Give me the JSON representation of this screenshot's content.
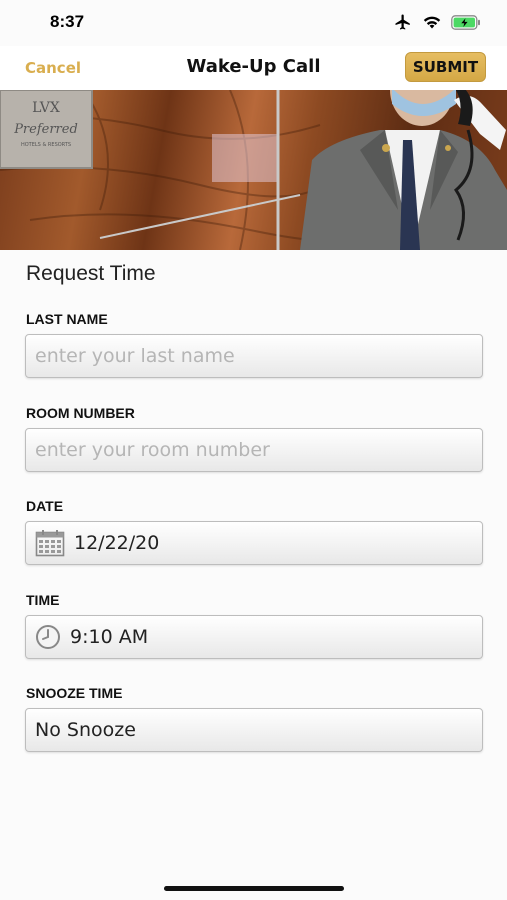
{
  "status": {
    "time": "8:37",
    "icons": [
      "airplane-icon",
      "wifi-icon",
      "battery-charging-icon"
    ],
    "battery_color": "#4cd964"
  },
  "nav": {
    "cancel_label": "Cancel",
    "title": "Wake-Up Call",
    "submit_label": "SUBMIT"
  },
  "colors": {
    "accent": "#d9ae4f",
    "submit_bg": "#e0b556"
  },
  "hero": {
    "sign_brand": "LVX",
    "sign_script": "Preferred",
    "sign_sub": "HOTELS & RESORTS"
  },
  "form": {
    "section_title": "Request Time",
    "last_name": {
      "label": "LAST NAME",
      "placeholder": "enter your last name",
      "value": ""
    },
    "room_number": {
      "label": "ROOM NUMBER",
      "placeholder": "enter your room number",
      "value": ""
    },
    "date": {
      "label": "DATE",
      "value": "12/22/20",
      "icon": "calendar-icon"
    },
    "time": {
      "label": "TIME",
      "value": "9:10 AM",
      "icon": "clock-icon"
    },
    "snooze": {
      "label": "SNOOZE TIME",
      "value": "No Snooze"
    }
  }
}
